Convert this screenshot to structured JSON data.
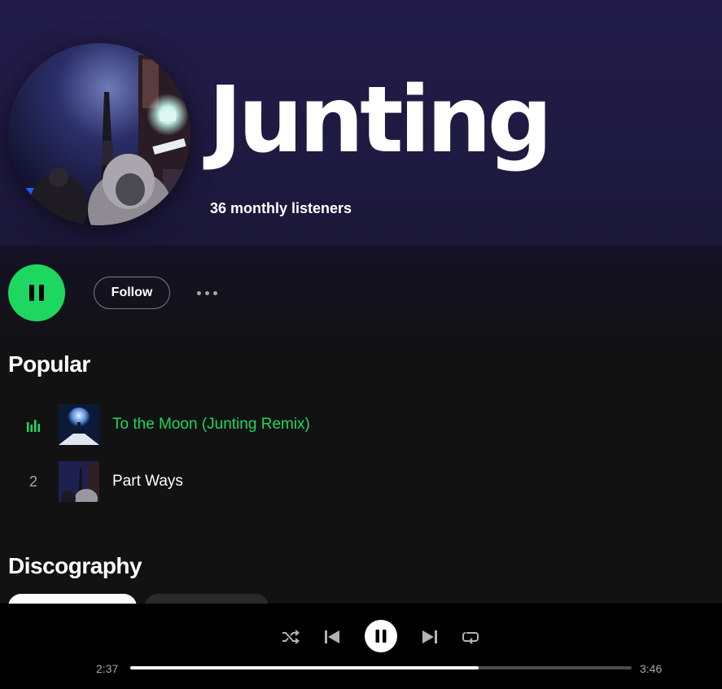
{
  "artist": {
    "name": "Junting",
    "monthly_listeners": "36 monthly listeners"
  },
  "actions": {
    "follow_label": "Follow",
    "play_state": "pause"
  },
  "popular": {
    "title": "Popular",
    "tracks": [
      {
        "index": "1",
        "title": "To the Moon (Junting Remix)",
        "playing": true
      },
      {
        "index": "2",
        "title": "Part Ways",
        "playing": false
      }
    ]
  },
  "discography": {
    "title": "Discography"
  },
  "player": {
    "elapsed": "2:37",
    "duration": "3:46",
    "progress_fraction": 0.695,
    "controls": [
      "shuffle-icon",
      "previous-icon",
      "pause-icon",
      "next-icon",
      "repeat-icon"
    ]
  },
  "colors": {
    "accent": "#1ed760",
    "header_bg": "#231c4a",
    "page_bg": "#121212",
    "player_bg": "#000000"
  }
}
